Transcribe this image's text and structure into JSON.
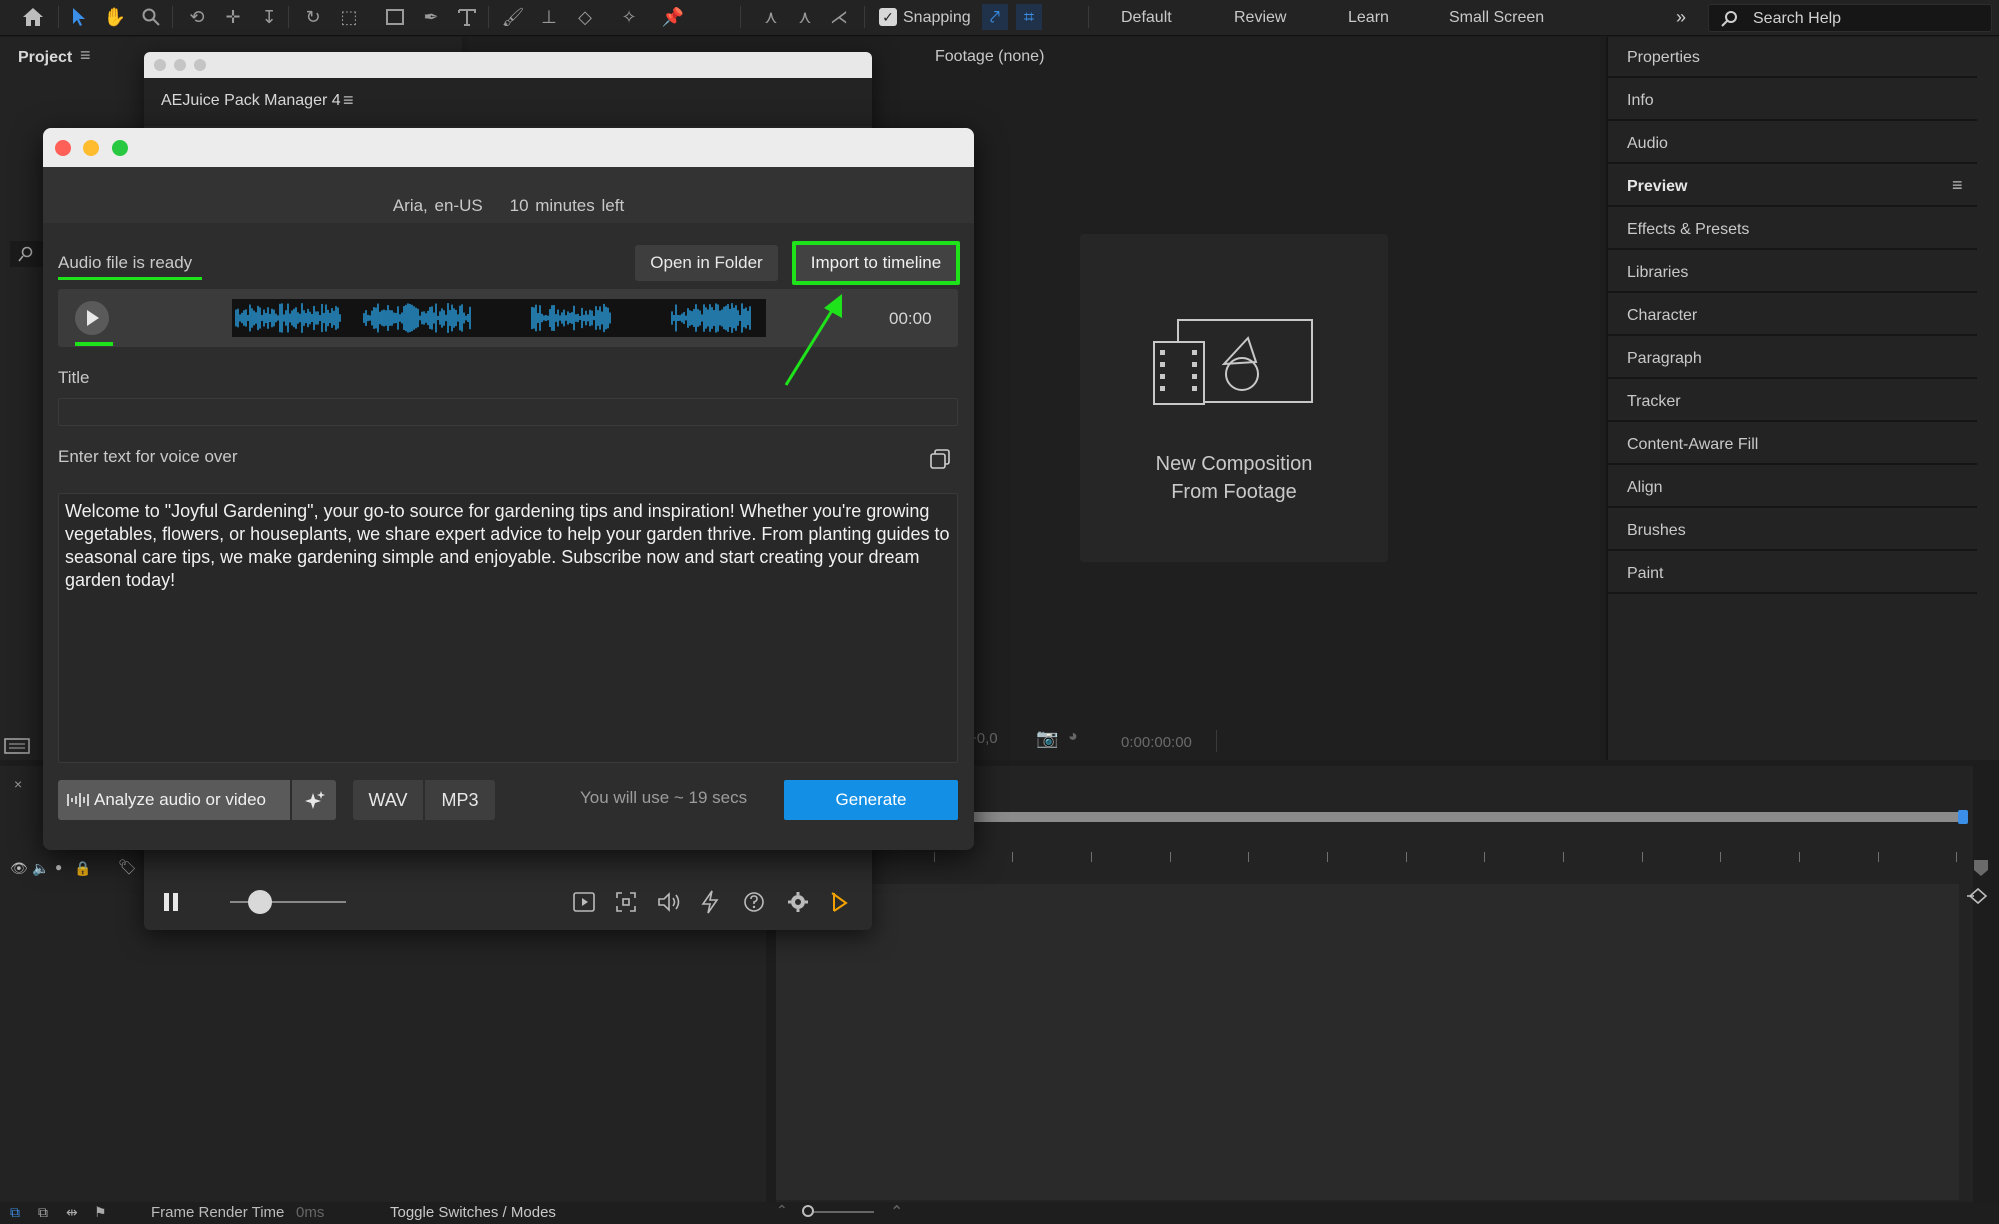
{
  "toolbar": {
    "snapping_label": "Snapping",
    "workspaces": [
      "Default",
      "Review",
      "Learn",
      "Small Screen"
    ],
    "search_placeholder": "Search Help"
  },
  "project_panel": {
    "title": "Project"
  },
  "footage_panel": {
    "title": "Footage (none)",
    "new_comp_line1": "New Composition",
    "new_comp_line2": "From Footage",
    "footer_text": "+0,0",
    "timecode": "0:00:00:00"
  },
  "right_panel": {
    "items": [
      "Properties",
      "Info",
      "Audio",
      "Preview",
      "Effects & Presets",
      "Libraries",
      "Character",
      "Paragraph",
      "Tracker",
      "Content-Aware Fill",
      "Align",
      "Brushes",
      "Paint"
    ]
  },
  "status_bar": {
    "frame_render_label": "Frame Render Time",
    "frame_render_value": "0ms",
    "toggle_label": "Toggle Switches / Modes"
  },
  "pack_manager": {
    "tab_label": "AEJuice Pack Manager 4"
  },
  "dialog": {
    "voice": "Aria, en-US",
    "time_left": "10 minutes left",
    "status": "Audio file is ready",
    "open_folder": "Open in Folder",
    "import_timeline": "Import to timeline",
    "player_time": "00:00",
    "title_label": "Title",
    "title_value": "",
    "voice_label": "Enter text for voice over",
    "voice_text": "Welcome to \"Joyful Gardening\", your go-to source for gardening tips and inspiration! Whether you're growing vegetables, flowers, or houseplants, we share expert advice to help your garden thrive. From planting guides to seasonal care tips, we make gardening simple and enjoyable. Subscribe now and start creating your dream garden today!",
    "analyze_label": "Analyze audio or video",
    "wav_label": "WAV",
    "mp3_label": "MP3",
    "usage": "You will use ~ 19 secs",
    "generate_label": "Generate"
  },
  "colors": {
    "highlight": "#1ee31a",
    "generate": "#138fe6",
    "waveform": "#2aa3e6",
    "active_tool": "#3b8fe8"
  }
}
